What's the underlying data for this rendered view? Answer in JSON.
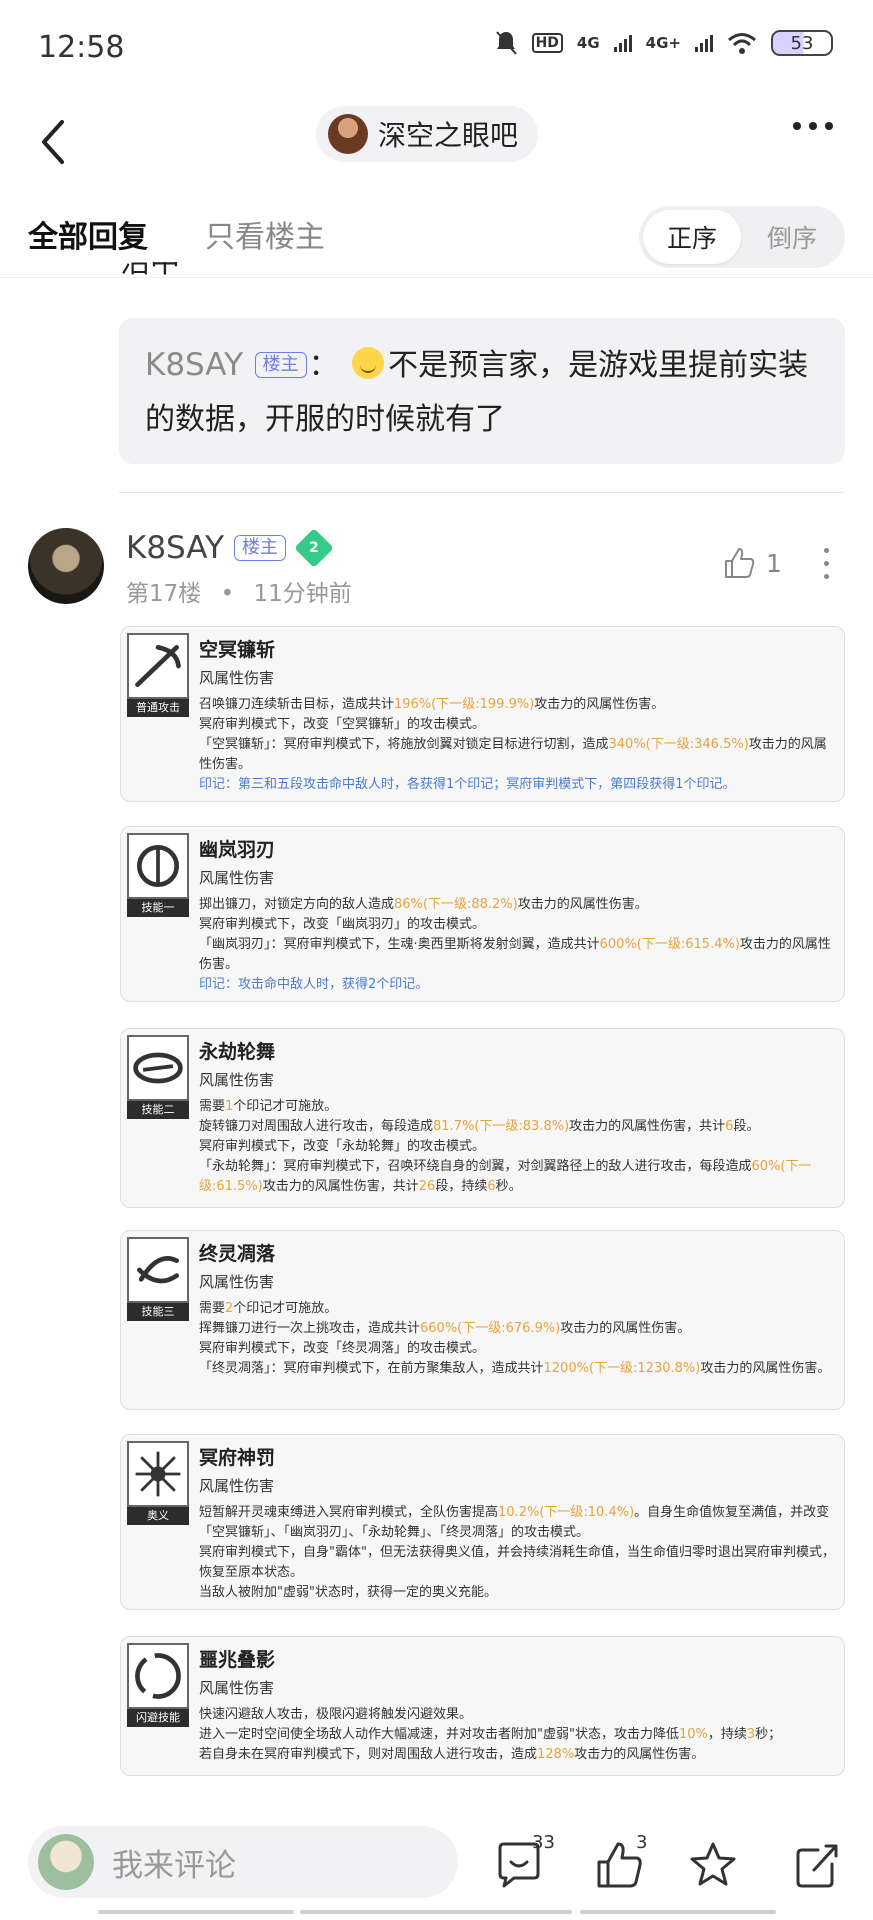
{
  "status_bar": {
    "time": "12:58",
    "network_a": "4G",
    "network_b": "4G+",
    "battery": "53"
  },
  "nav": {
    "forum_name": "深空之眼吧"
  },
  "tabs": {
    "all": "全部回复",
    "op_only": "只看楼主",
    "asc": "正序",
    "desc": "倒序"
  },
  "cut_text": "沼中",
  "reply": {
    "user": "K8SAY",
    "badge": "楼主",
    "colon": "：",
    "text": "不是预言家，是游戏里提前实装的数据，开服的时候就有了"
  },
  "post": {
    "user": "K8SAY",
    "badge": "楼主",
    "level": "2",
    "floor": "第17楼",
    "dot": "•",
    "time": "11分钟前",
    "likes": "1"
  },
  "skills": [
    {
      "name": "空冥镰斩",
      "tag": "普通攻击",
      "attr": "风属性伤害",
      "lines": [
        [
          "召唤镰刀连续斩击目标，造成共计",
          {
            "hl": "196%(下一级:199.9%)"
          },
          "攻击力的风属性伤害。"
        ],
        [
          "冥府审判模式下，改变「空冥镰斩」的攻击模式。"
        ],
        [
          "「空冥镰斩」：冥府审判模式下，将施放剑翼对锁定目标进行切割，造成",
          {
            "hl": "340%(下一级:346.5%)"
          },
          "攻击力的风属性伤害。"
        ],
        [
          {
            "blue": "印记：第三和五段攻击命中敌人时，各获得1个印记；冥府审判模式下，第四段获得1个印记。"
          }
        ]
      ]
    },
    {
      "name": "幽岚羽刃",
      "tag": "技能一",
      "attr": "风属性伤害",
      "lines": [
        [
          "掷出镰刀，对锁定方向的敌人造成",
          {
            "hl": "86%(下一级:88.2%)"
          },
          "攻击力的风属性伤害。"
        ],
        [
          "冥府审判模式下，改变「幽岚羽刃」的攻击模式。"
        ],
        [
          "「幽岚羽刃」：冥府审判模式下，生魂·奥西里斯将发射剑翼，造成共计",
          {
            "hl": "600%(下一级:615.4%)"
          },
          "攻击力的风属性伤害。"
        ],
        [
          {
            "blue": "印记：攻击命中敌人时，获得2个印记。"
          }
        ]
      ]
    },
    {
      "name": "永劫轮舞",
      "tag": "技能二",
      "attr": "风属性伤害",
      "lines": [
        [
          "需要",
          {
            "hl": "1"
          },
          "个印记才可施放。"
        ],
        [
          "旋转镰刀对周围敌人进行攻击，每段造成",
          {
            "hl": "81.7%(下一级:83.8%)"
          },
          "攻击力的风属性伤害，共计",
          {
            "hl": "6"
          },
          "段。"
        ],
        [
          "冥府审判模式下，改变「永劫轮舞」的攻击模式。"
        ],
        [
          "「永劫轮舞」：冥府审判模式下，召唤环绕自身的剑翼，对剑翼路径上的敌人进行攻击，每段造成",
          {
            "hl": "60%(下一级:61.5%)"
          },
          "攻击力的风属性伤害，共计",
          {
            "hl": "26"
          },
          "段，持续",
          {
            "hl": "6"
          },
          "秒。"
        ]
      ]
    },
    {
      "name": "终灵凋落",
      "tag": "技能三",
      "attr": "风属性伤害",
      "lines": [
        [
          "需要",
          {
            "hl": "2"
          },
          "个印记才可施放。"
        ],
        [
          "挥舞镰刀进行一次上挑攻击，造成共计",
          {
            "hl": "660%(下一级:676.9%)"
          },
          "攻击力的风属性伤害。"
        ],
        [
          "冥府审判模式下，改变「终灵凋落」的攻击模式。"
        ],
        [
          "「终灵凋落」：冥府审判模式下，在前方聚集敌人，造成共计",
          {
            "hl": "1200%(下一级:1230.8%)"
          },
          "攻击力的风属性伤害。"
        ]
      ]
    },
    {
      "name": "冥府神罚",
      "tag": "奥义",
      "attr": "风属性伤害",
      "lines": [
        [
          "短暂解开灵魂束缚进入冥府审判模式，全队伤害提高",
          {
            "hl": "10.2%(下一级:10.4%)"
          },
          "。自身生命值恢复至满值，并改变「空冥镰斩」、「幽岚羽刃」、「永劫轮舞」、「终灵凋落」的攻击模式。"
        ],
        [
          "冥府审判模式下，自身\"霸体\"，但无法获得奥义值，并会持续消耗生命值，当生命值归零时退出冥府审判模式，恢复至原本状态。"
        ],
        [
          "当敌人被附加\"虚弱\"状态时，获得一定的奥义充能。"
        ]
      ]
    },
    {
      "name": "噩兆叠影",
      "tag": "闪避技能",
      "attr": "风属性伤害",
      "lines": [
        [
          "快速闪避敌人攻击，极限闪避将触发闪避效果。"
        ],
        [
          "进入一定时空间使全场敌人动作大幅减速，并对攻击者附加\"虚弱\"状态，攻击力降低",
          {
            "hl": "10%"
          },
          "，持续",
          {
            "hl": "3"
          },
          "秒；"
        ],
        [
          "若自身未在冥府审判模式下，则对周围敌人进行攻击，造成",
          {
            "hl": "128%"
          },
          "攻击力的风属性伤害。"
        ]
      ]
    }
  ],
  "bottom_bar": {
    "placeholder": "我来评论",
    "comment_count": "33",
    "like_count": "3"
  }
}
